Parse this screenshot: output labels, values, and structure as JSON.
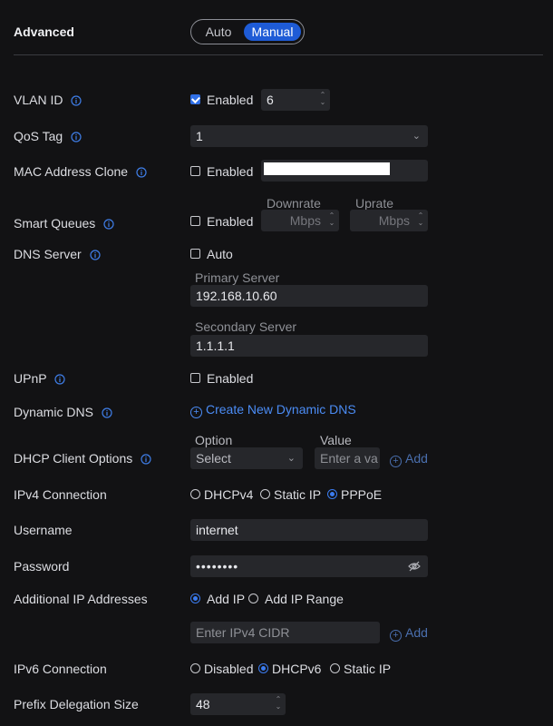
{
  "header": {
    "title": "Advanced",
    "mode_auto": "Auto",
    "mode_manual": "Manual"
  },
  "vlan": {
    "label": "VLAN ID",
    "enabled_label": "Enabled",
    "value": "6"
  },
  "qos": {
    "label": "QoS Tag",
    "value": "1"
  },
  "mac_clone": {
    "label": "MAC Address Clone",
    "enabled_label": "Enabled"
  },
  "smart_queues": {
    "label": "Smart Queues",
    "enabled_label": "Enabled",
    "downrate_label": "Downrate",
    "uprate_label": "Uprate",
    "downrate_placeholder": "Mbps",
    "uprate_placeholder": "Mbps"
  },
  "dns": {
    "label": "DNS Server",
    "auto_label": "Auto",
    "primary_label": "Primary Server",
    "primary_value": "192.168.10.60",
    "secondary_label": "Secondary Server",
    "secondary_value": "1.1.1.1"
  },
  "upnp": {
    "label": "UPnP",
    "enabled_label": "Enabled"
  },
  "ddns": {
    "label": "Dynamic DNS",
    "create_link": "Create New Dynamic DNS"
  },
  "dhcp_options": {
    "label": "DHCP Client Options",
    "option_label": "Option",
    "value_label": "Value",
    "option_select": "Select",
    "value_placeholder": "Enter a va",
    "add_label": "Add"
  },
  "ipv4": {
    "label": "IPv4 Connection",
    "options": [
      "DHCPv4",
      "Static IP",
      "PPPoE"
    ],
    "selected": "PPPoE"
  },
  "username": {
    "label": "Username",
    "value": "internet"
  },
  "password": {
    "label": "Password",
    "value": "••••••••"
  },
  "additional_ip": {
    "label": "Additional IP Addresses",
    "add_ip_label": "Add IP",
    "add_range_label": "Add IP Range",
    "cidr_placeholder": "Enter IPv4 CIDR",
    "add_label": "Add"
  },
  "ipv6": {
    "label": "IPv6 Connection",
    "options": [
      "Disabled",
      "DHCPv6",
      "Static IP"
    ],
    "selected": "DHCPv6"
  },
  "prefix": {
    "label": "Prefix Delegation Size",
    "value": "48"
  },
  "colors": {
    "background": "#121214",
    "accent": "#1e5bd6",
    "link": "#4b8cf5",
    "field": "#26272b"
  }
}
